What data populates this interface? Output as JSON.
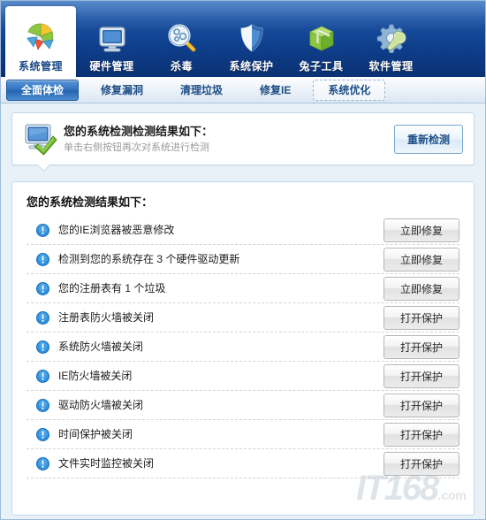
{
  "window": {
    "title": "系统管理"
  },
  "toolbar": {
    "items": [
      {
        "label": "系统管理",
        "icon": "pie-chart-icon",
        "active": true
      },
      {
        "label": "硬件管理",
        "icon": "monitor-icon",
        "active": false
      },
      {
        "label": "杀毒",
        "icon": "magnifier-icon",
        "active": false
      },
      {
        "label": "系统保护",
        "icon": "shield-icon",
        "active": false
      },
      {
        "label": "兔子工具",
        "icon": "green-box-icon",
        "active": false
      },
      {
        "label": "软件管理",
        "icon": "gear-wrench-icon",
        "active": false
      }
    ]
  },
  "tabs": [
    {
      "label": "全面体检",
      "state": "active"
    },
    {
      "label": "修复漏洞",
      "state": "normal"
    },
    {
      "label": "清理垃圾",
      "state": "normal"
    },
    {
      "label": "修复IE",
      "state": "normal"
    },
    {
      "label": "系统优化",
      "state": "hover"
    }
  ],
  "info_panel": {
    "icon": "monitor-check-icon",
    "title": "您的系统检测检测结果如下：",
    "subtitle": "单击右侧按钮再次对系统进行检测",
    "button_label": "重新检测"
  },
  "results": {
    "heading": "您的系统检测结果如下：",
    "row_icon": "warning-exclamation-icon",
    "rows": [
      {
        "text": "您的IE浏览器被恶意修改",
        "action": "立即修复"
      },
      {
        "text": "检测到您的系统存在 3 个硬件驱动更新",
        "action": "立即修复"
      },
      {
        "text": "您的注册表有 1 个垃圾",
        "action": "立即修复"
      },
      {
        "text": "注册表防火墙被关闭",
        "action": "打开保护"
      },
      {
        "text": "系统防火墙被关闭",
        "action": "打开保护"
      },
      {
        "text": "IE防火墙被关闭",
        "action": "打开保护"
      },
      {
        "text": "驱动防火墙被关闭",
        "action": "打开保护"
      },
      {
        "text": "时间保护被关闭",
        "action": "打开保护"
      },
      {
        "text": "文件实时监控被关闭",
        "action": "打开保护"
      }
    ]
  },
  "watermark": {
    "text": "IT168",
    "domain": ".com"
  },
  "colors": {
    "header_blue_top": "#2f6fc0",
    "header_blue_bottom": "#0b3173",
    "tab_active_blue": "#2565b0",
    "panel_border": "#c3d7e8",
    "page_background": "#e9f1f8",
    "warning_icon_blue": "#2e90df",
    "primary_button_text": "#1d4f88"
  }
}
